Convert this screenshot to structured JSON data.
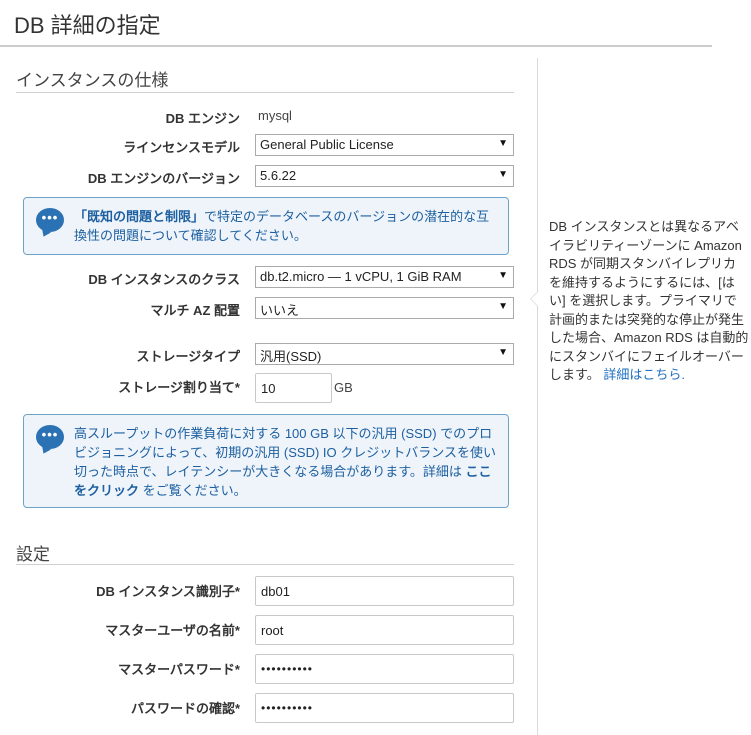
{
  "page_title": "DB 詳細の指定",
  "spec_section": {
    "title": "インスタンスの仕様",
    "engine": {
      "label": "DB エンジン",
      "value": "mysql"
    },
    "license": {
      "label": "ラインセンスモデル",
      "value": "General Public License"
    },
    "version": {
      "label": "DB エンジンのバージョン",
      "value": "5.6.22"
    },
    "version_notice": {
      "link_text": "「既知の問題と制限」",
      "text": "で特定のデータベースのバージョンの潜在的な互換性の問題について確認してください。"
    },
    "instance_class": {
      "label": "DB インスタンスのクラス",
      "value": "db.t2.micro — 1 vCPU, 1 GiB RAM"
    },
    "multi_az": {
      "label": "マルチ AZ 配置",
      "value": "いいえ"
    },
    "storage_type": {
      "label": "ストレージタイプ",
      "value": "汎用(SSD)"
    },
    "storage_alloc": {
      "label": "ストレージ割り当て*",
      "value": "10",
      "unit": "GB"
    },
    "storage_notice": {
      "text": "高スループットの作業負荷に対する 100 GB 以下の汎用 (SSD) でのプロビジョニングによって、初期の汎用 (SSD) IO クレジットバランスを使い切った時点で、レイテンシーが大きくなる場合があります。詳細は",
      "link_text": "ここをクリック",
      "text_after": "をご覧ください。"
    }
  },
  "settings_section": {
    "title": "設定",
    "identifier": {
      "label": "DB インスタンス識別子*",
      "value": "db01"
    },
    "master_user": {
      "label": "マスターユーザの名前*",
      "value": "root"
    },
    "master_password": {
      "label": "マスターパスワード*",
      "value": "••••••••••"
    },
    "confirm_password": {
      "label": "パスワードの確認*",
      "value": "••••••••••"
    }
  },
  "sidebar": {
    "help_text": "DB インスタンスとは異なるアベイラビリティーゾーンに Amazon RDS が同期スタンバイレプリカを維持するようにするには、[はい] を選択します。プライマリで計画的または突発的な停止が発生した場合、Amazon RDS は自動的にスタンバイにフェイルオーバーします。",
    "link": "詳細はこちら."
  },
  "icons": {
    "caret": "▼",
    "notice": "chat-bubble-icon"
  },
  "colors": {
    "link": "#1d5fa0",
    "notice_border": "#6ea3c9",
    "notice_bg": "#eef4fa",
    "bubble": "#2b72b5"
  }
}
